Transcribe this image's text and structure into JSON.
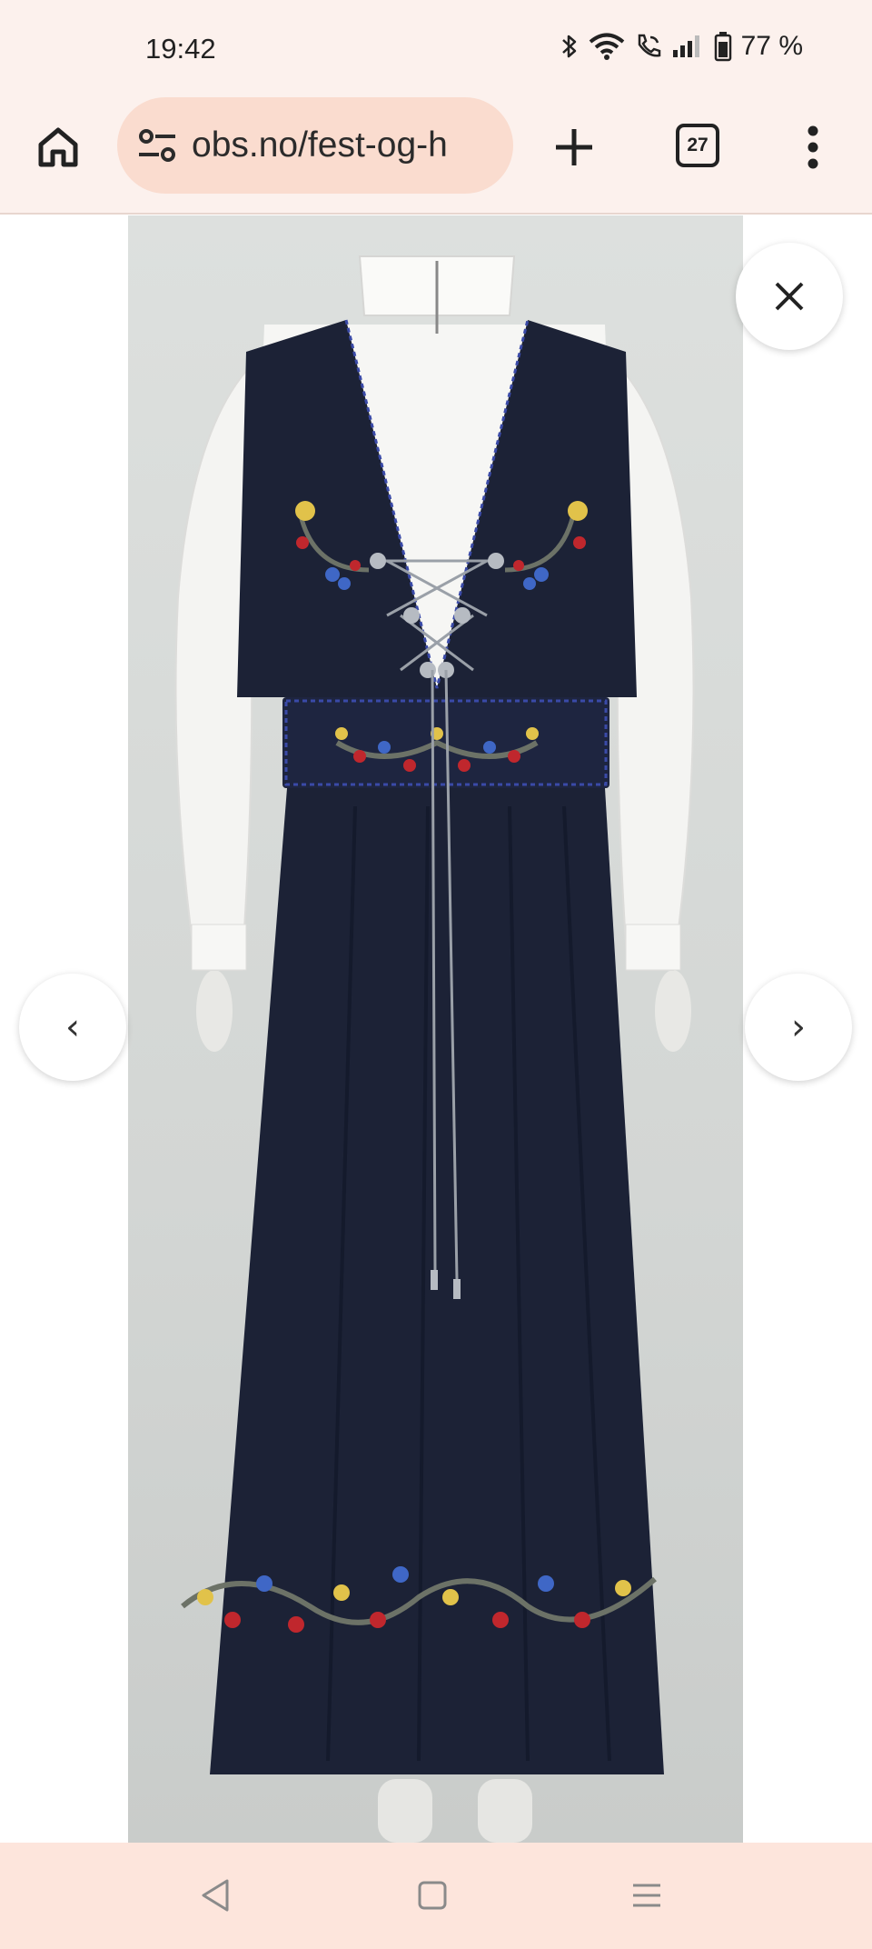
{
  "status_bar": {
    "time": "19:42",
    "battery": "77 %",
    "icons": [
      "bluetooth-icon",
      "wifi-icon",
      "wifi-call-icon",
      "signal-icon",
      "battery-icon"
    ]
  },
  "browser": {
    "url": "obs.no/fest-og-h",
    "tab_count": "27",
    "icons": [
      "home-icon",
      "site-settings-icon",
      "plus-icon",
      "tabs-icon",
      "more-vert-icon"
    ]
  },
  "viewer": {
    "close_icon": "close-icon",
    "prev_glyph": "‹",
    "next_glyph": "›"
  },
  "nav_bar": {
    "icons": [
      "back-icon",
      "home-square-icon",
      "recents-icon"
    ]
  },
  "colors": {
    "chrome_background": "#fcf1ed",
    "url_pill": "#fadccf",
    "nav_bar": "#fde5dc",
    "dress_navy": "#1c2236"
  }
}
